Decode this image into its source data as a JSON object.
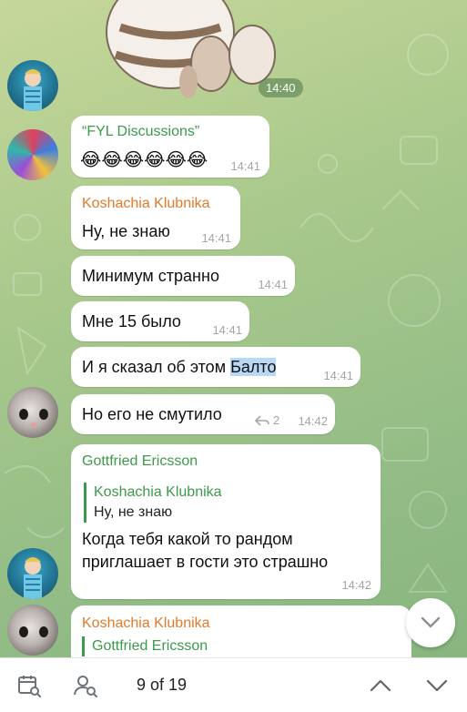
{
  "sticker": {
    "time": "14:40"
  },
  "messages": [
    {
      "forward_title": "“FYL Discussions”",
      "emoji": "😂😂😂😂😂😂",
      "time": "14:41"
    },
    {
      "sender": "Koshachia Klubnika",
      "text": "Ну, не знаю",
      "time": "14:41"
    },
    {
      "text": "Минимум странно",
      "time": "14:41"
    },
    {
      "text": "Мне 15 было",
      "time": "14:41"
    },
    {
      "text_before": "И я сказал об этом ",
      "text_highlight": "Балто",
      "time": "14:41"
    },
    {
      "text": "Но его не смутило",
      "replies_count": "2",
      "time": "14:42"
    },
    {
      "sender": "Gottfried Ericsson",
      "reply_to_name": "Koshachia Klubnika",
      "reply_to_text": "Ну, не знаю",
      "text_line1": "Когда тебя какой то рандом",
      "text_line2": "приглашает в гости это страшно",
      "time": "14:42"
    },
    {
      "sender": "Koshachia Klubnika",
      "reply_to_name": "Gottfried Ericsson"
    }
  ],
  "search_bar": {
    "counter": "9 of 19"
  },
  "icons": {
    "calendar": "calendar-search-icon",
    "user": "user-search-icon",
    "up": "chevron-up-icon",
    "down": "chevron-down-icon",
    "scroll": "scroll-down-icon"
  },
  "colors": {
    "sender_orange": "#e07b2c",
    "sender_green": "#3b9a4b",
    "highlight": "#b9d8f5"
  }
}
